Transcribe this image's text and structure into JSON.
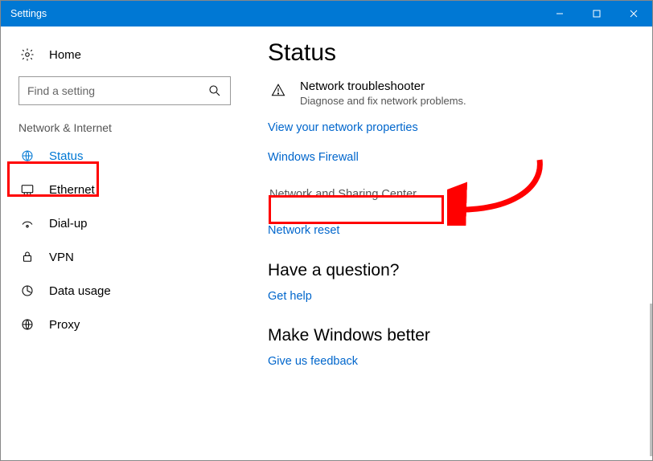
{
  "window": {
    "title": "Settings"
  },
  "sidebar": {
    "home_label": "Home",
    "search_placeholder": "Find a setting",
    "section_label": "Network & Internet",
    "items": [
      {
        "label": "Status"
      },
      {
        "label": "Ethernet"
      },
      {
        "label": "Dial-up"
      },
      {
        "label": "VPN"
      },
      {
        "label": "Data usage"
      },
      {
        "label": "Proxy"
      }
    ]
  },
  "main": {
    "title": "Status",
    "troubleshooter_title": "Network troubleshooter",
    "troubleshooter_sub": "Diagnose and fix network problems.",
    "links": {
      "view_properties": "View your network properties",
      "firewall": "Windows Firewall",
      "sharing_center": "Network and Sharing Center",
      "reset": "Network reset"
    },
    "question_heading": "Have a question?",
    "get_help": "Get help",
    "better_heading": "Make Windows better",
    "feedback": "Give us feedback"
  }
}
